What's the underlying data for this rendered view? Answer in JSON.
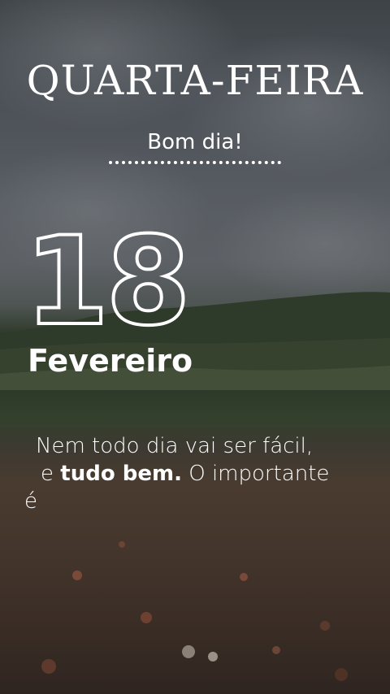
{
  "header": {
    "day_of_week": "QUARTA-FEIRA",
    "greeting": "Bom dia!"
  },
  "date": {
    "day": "18",
    "month": "Fevereiro"
  },
  "quote": {
    "line1": "Nem todo dia vai ser fácil,",
    "line2_prefix": "e ",
    "line2_bold": "tudo bem.",
    "line2_suffix": " O importante",
    "line3": "é"
  },
  "colors": {
    "text": "#ffffff",
    "sky": "#575c62",
    "vegetation": "#2f3b2c",
    "soil": "#43352b"
  }
}
